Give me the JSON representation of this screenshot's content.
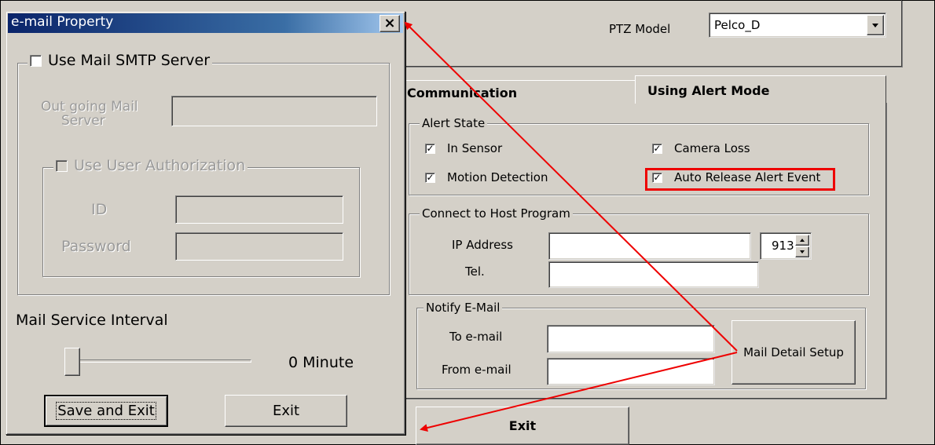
{
  "colors": {
    "dialog_bg": "#d4d0c8",
    "title_bar": "#1f3e9e",
    "annotation_red": "#ee0000"
  },
  "main_window": {
    "ptz_label": "PTZ Model",
    "ptz_value": "Pelco_D",
    "tabs": [
      {
        "label": "Communication",
        "active": false
      },
      {
        "label": "Using Alert Mode",
        "active": true
      }
    ],
    "alert_state": {
      "legend": "Alert State",
      "items": [
        {
          "label": "In Sensor",
          "checked": true
        },
        {
          "label": "Camera Loss",
          "checked": true
        },
        {
          "label": "Motion Detection",
          "checked": true
        },
        {
          "label": "Auto Release Alert Event",
          "checked": true,
          "highlighted": true
        }
      ]
    },
    "connect_host": {
      "legend": "Connect to Host Program",
      "ip_label": "IP Address",
      "ip_value": "",
      "port_value": "913",
      "tel_label": "Tel.",
      "tel_value": ""
    },
    "notify_email": {
      "legend": "Notify E-Mail",
      "to_label": "To e-mail",
      "to_value": "",
      "from_label": "From e-mail",
      "from_value": "",
      "setup_button": "Mail Detail Setup"
    },
    "exit_button": "Exit"
  },
  "email_dialog": {
    "title": "e-mail Property",
    "close_glyph": "×",
    "smtp": {
      "label": "Use Mail SMTP Server",
      "checked": false,
      "server_label_line1": "Out going Mail",
      "server_label_line2": "Server",
      "server_value": ""
    },
    "auth": {
      "label": "Use User Authorization",
      "checked": false,
      "id_label": "ID",
      "id_value": "",
      "password_label": "Password",
      "password_value": ""
    },
    "interval_label": "Mail Service Interval",
    "interval_value": "0 Minute",
    "interval_minutes": 0,
    "save_button": "Save and Exit",
    "exit_button": "Exit"
  }
}
